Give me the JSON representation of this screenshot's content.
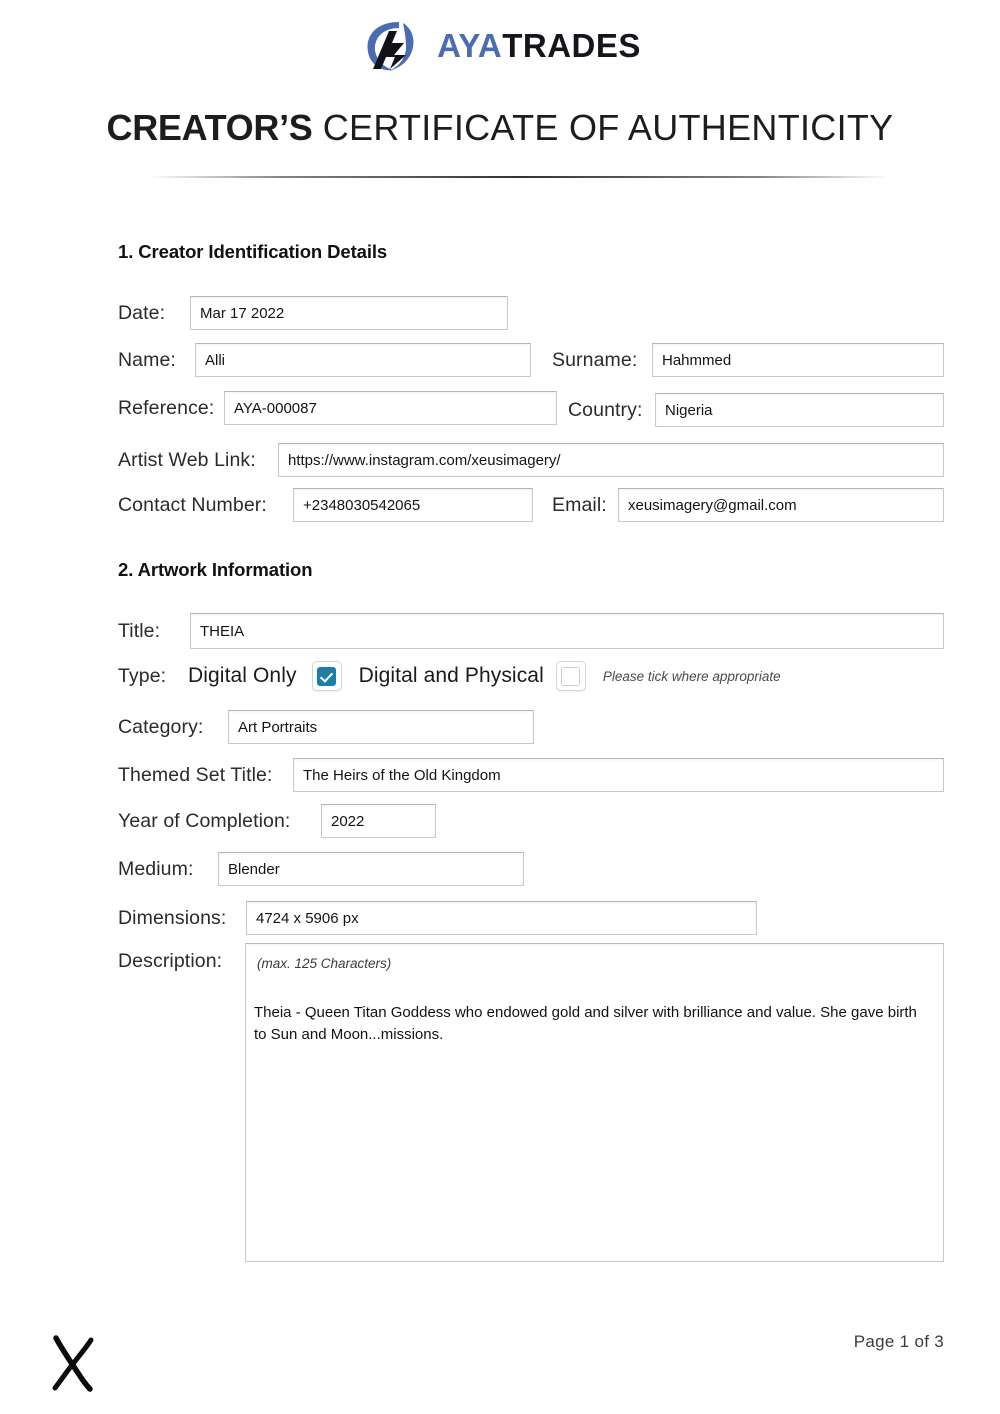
{
  "brand": {
    "logo_icon": "ayatrades-logo-icon",
    "name_part1": "AYA",
    "name_part2": "TRADES",
    "accent_blue": "#4b6cb0",
    "dark": "#14161c"
  },
  "document": {
    "title_strong": "CREATOR’S",
    "title_light": "CERTIFICATE OF AUTHENTICITY"
  },
  "sections": {
    "creator": {
      "heading": "1. Creator Identification Details",
      "date": {
        "label": "Date:",
        "value": "Mar 17 2022"
      },
      "name": {
        "label": "Name:",
        "value": "Alli"
      },
      "surname": {
        "label": "Surname:",
        "value": "Hahmmed"
      },
      "reference": {
        "label": "Reference:",
        "value": "AYA-000087"
      },
      "country": {
        "label": "Country:",
        "value": "Nigeria"
      },
      "web_link": {
        "label": "Artist Web Link:",
        "value": "https://www.instagram.com/xeusimagery/"
      },
      "contact": {
        "label": "Contact Number:",
        "value": "+2348030542065"
      },
      "email": {
        "label": "Email:",
        "value": "xeusimagery@gmail.com"
      }
    },
    "artwork": {
      "heading": "2. Artwork Information",
      "title": {
        "label": "Title:",
        "value": "THEIA"
      },
      "type": {
        "label": "Type:",
        "option1_label": "Digital Only",
        "option1_checked": true,
        "option2_label": "Digital and Physical",
        "option2_checked": false,
        "note": "Please tick where appropriate",
        "checked_color": "#1d7ea8"
      },
      "category": {
        "label": "Category:",
        "value": "Art Portraits"
      },
      "themed_set": {
        "label": "Themed Set Title:",
        "value": "The Heirs of the Old Kingdom"
      },
      "year": {
        "label": "Year of Completion:",
        "value": "2022"
      },
      "medium": {
        "label": "Medium:",
        "value": "Blender"
      },
      "dimensions": {
        "label": "Dimensions:",
        "value": "4724 x 5906 px"
      },
      "description": {
        "label": "Description:",
        "hint": "(max. 125 Characters)",
        "value": "Theia - Queen Titan Goddess who endowed gold and silver with brilliance and value. She gave birth to Sun and Moon...missions."
      }
    }
  },
  "footer": {
    "page_label": "Page 1 of 3",
    "signature_icon": "signature-x-mark"
  }
}
